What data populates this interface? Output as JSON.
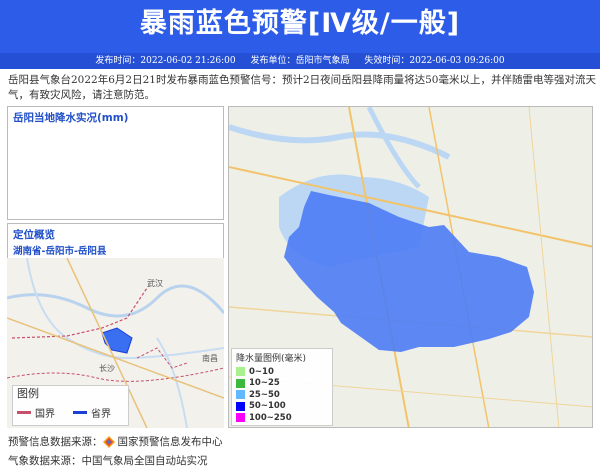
{
  "header": {
    "title": "暴雨蓝色预警[Ⅳ级/一般]",
    "issue_time": "发布时间：2022-06-02 21:26:00",
    "issuer": "发布单位：岳阳市气象局",
    "expire_time": "失效时间：2022-06-03 09:26:00"
  },
  "description": "岳阳县气象台2022年6月2日21时发布暴雨蓝色预警信号：预计2日夜间岳阳县降雨量将达50毫米以上，并伴随雷电等强对流天气，有致灾风险，请注意防范。",
  "rain_panel": {
    "title": "岳阳当地降水实况(mm)"
  },
  "location_panel": {
    "title": "定位概览",
    "subtitle": "湖南省-岳阳市-岳阳县",
    "map_labels": [
      "武汉",
      "长沙",
      "南昌"
    ],
    "legend_title": "图例",
    "legend_national": "国界",
    "legend_provincial": "省界"
  },
  "rain_legend": {
    "title": "降水量图例(毫米)",
    "items": [
      {
        "label": "0~10",
        "color": "#a9f08e"
      },
      {
        "label": "10~25",
        "color": "#3dba3d"
      },
      {
        "label": "25~50",
        "color": "#61b8ff"
      },
      {
        "label": "50~100",
        "color": "#0000fe"
      },
      {
        "label": "100~250",
        "color": "#fa00fa"
      }
    ]
  },
  "footer": {
    "source_warning_prefix": "预警信息数据来源：",
    "source_warning_name": "国家预警信息发布中心",
    "source_weather": "气象数据来源：中国气象局全国自动站实况"
  },
  "colors": {
    "banner": "#2d5ce8",
    "warning_area": "#4d7cf5",
    "national_border": "#c8506a",
    "provincial_border": "#1a3fd6"
  },
  "icons": [
    "warning-release-logo"
  ]
}
